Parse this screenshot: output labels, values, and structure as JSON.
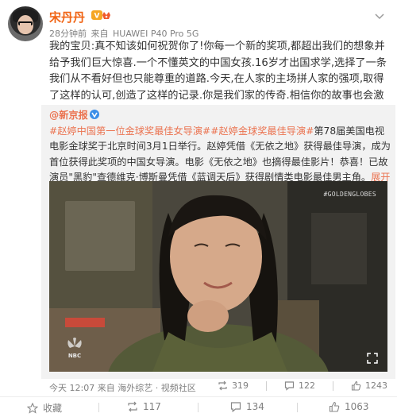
{
  "post": {
    "username": "宋丹丹",
    "meta_time": "28分钟前",
    "meta_source_prefix": "来自",
    "meta_device": "HUAWEI P40 Pro 5G",
    "body": "我的宝贝:真不知该如何祝贺你了!你每一个新的奖项,都超出我们的想象并给予我们巨大惊喜.一个不懂英文的中国女孩.16岁才出国求学,选择了一条我们从不看好但也只能尊重的道路.今天,在人家的主场拼人家的强项,取得了这样的认可,创造了这样的记录.你是我们家的传奇.相信你的故事也会激励无数中国的孩子们~"
  },
  "repost": {
    "handle": "@新京报",
    "topic1": "#赵婷中国第一位金球奖最佳女导演#",
    "topic2": "#赵婷金球奖最佳导演#",
    "body": "第78届美国电视电影金球奖于北京时间3月1日举行。赵婷凭借《无依之地》获得最佳导演，成为首位获得此奖项的中国女导演。电影《无依之地》也摘得最佳影片！恭喜！已故演员\"黑豹\"查德维克·博斯曼凭借《蓝调天后》获得剧情类电影最佳男主角。",
    "expand_label": "展开全文",
    "video_watermark": "#GOLDENGLOBES",
    "network_label": "NBC",
    "footer_time": "今天 12:07",
    "footer_source": "来自 海外综艺 · 视频社区",
    "stats": {
      "reposts": "319",
      "comments": "122",
      "likes": "1243"
    }
  },
  "actions": {
    "favorite": "收藏",
    "repost": "117",
    "comment": "134",
    "like": "1063"
  },
  "colors": {
    "username": "#f06313",
    "link": "#eb7350",
    "meta": "#808080"
  }
}
